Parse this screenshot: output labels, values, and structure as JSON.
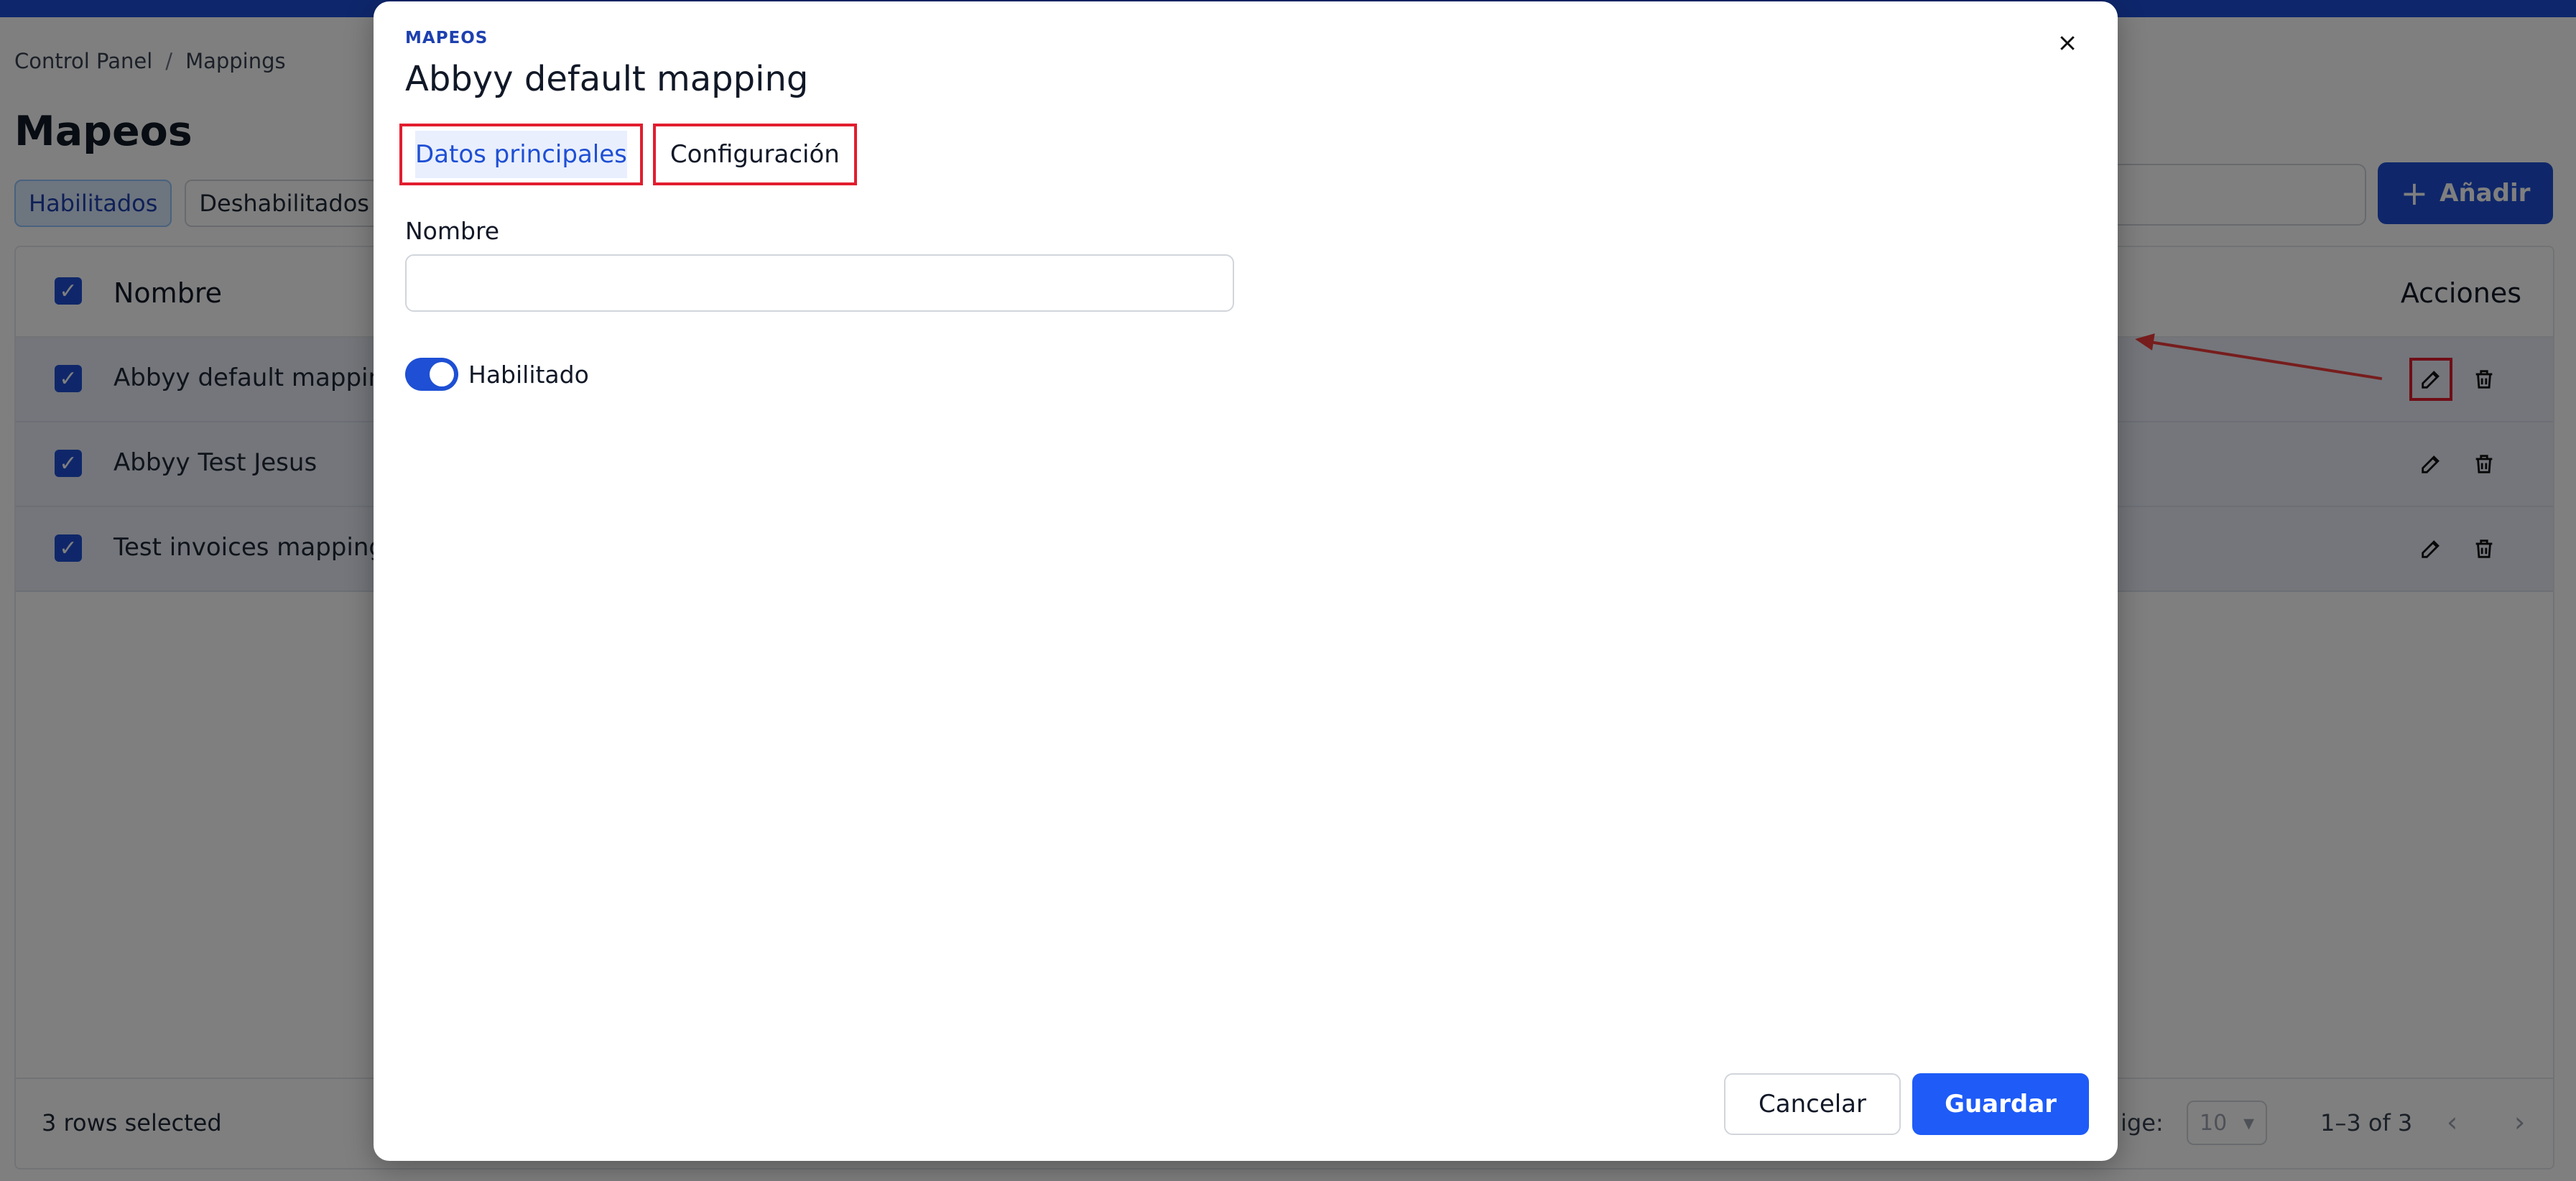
{
  "breadcrumb": {
    "items": [
      "Control Panel",
      "Mappings"
    ],
    "separator": "/"
  },
  "page": {
    "title": "Mapeos"
  },
  "filters": {
    "enabled_label": "Habilitados",
    "disabled_label": "Deshabilitados"
  },
  "toolbar": {
    "add_label": "Añadir"
  },
  "table": {
    "columns": {
      "name": "Nombre",
      "actions": "Acciones"
    },
    "rows": [
      {
        "name": "Abbyy default mapping",
        "checked": true
      },
      {
        "name": "Abbyy Test Jesus",
        "checked": true
      },
      {
        "name": "Test invoices mapping",
        "checked": true
      }
    ],
    "footer": {
      "selected_text": "3 rows selected",
      "rows_per_page_label": "ige:",
      "rows_per_page_value": "10",
      "range_text": "1–3 of 3"
    }
  },
  "modal": {
    "overline": "MAPEOS",
    "title": "Abbyy default mapping",
    "tabs": [
      "Datos principales",
      "Configuración"
    ],
    "active_tab": "Datos principales",
    "name_label": "Nombre",
    "name_value": "",
    "toggle_label": "Habilitado",
    "toggle_on": true,
    "cancel_label": "Cancelar",
    "save_label": "Guardar"
  },
  "colors": {
    "primary": "#1e4fd4",
    "annotation": "#e11d2e",
    "row_bg": "#e8ecf6"
  }
}
